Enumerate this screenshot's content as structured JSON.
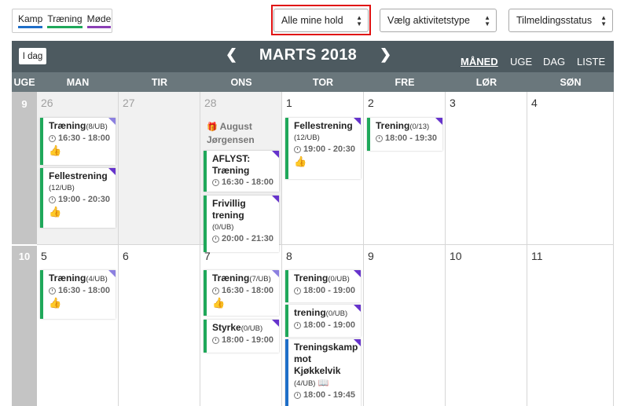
{
  "legend": {
    "kamp": "Kamp",
    "traening": "Træning",
    "mode": "Møde"
  },
  "filters": {
    "team": "Alle mine hold",
    "activity": "Vælg aktivitetstype",
    "status": "Tilmeldingsstatus"
  },
  "header": {
    "today": "I dag",
    "title": "MARTS 2018",
    "prev": "‹",
    "next": "›",
    "views": [
      "MÅNED",
      "UGE",
      "DAG",
      "LISTE"
    ],
    "active_view": "MÅNED"
  },
  "weekdays": [
    "UGE",
    "MAN",
    "TIR",
    "ONS",
    "TOR",
    "FRE",
    "LØR",
    "SØN"
  ],
  "colors": {
    "kamp": "#1e6ec8",
    "traening": "#1fa85a",
    "mode": "#8b3fb5",
    "header": "#4d5a60",
    "highlight": "#e01010"
  },
  "weeks": [
    {
      "number": "9",
      "days": [
        "26",
        "27",
        "28",
        "1",
        "2",
        "3",
        "4"
      ],
      "birthday": {
        "icon": "gift-icon",
        "name": "August Jørgensen"
      }
    },
    {
      "number": "10",
      "days": [
        "5",
        "6",
        "7",
        "8",
        "9",
        "10",
        "11"
      ]
    }
  ],
  "events": {
    "mon26_1": {
      "title": "Træning",
      "count": "(8/UB)",
      "time": "16:30 - 18:00"
    },
    "mon26_2": {
      "title": "Fellestrening",
      "count": "(12/UB)",
      "time": "19:00 - 20:30"
    },
    "wed28_1": {
      "title": "AFLYST: Træning",
      "time": "16:30 - 18:00"
    },
    "wed28_2": {
      "title": "Frivillig trening",
      "count": "(0/UB)",
      "time": "20:00 - 21:30"
    },
    "thu1_1": {
      "title": "Fellestrening",
      "count": "(12/UB)",
      "time": "19:00 - 20:30"
    },
    "fri2_1": {
      "title": "Trening",
      "count": "(0/13)",
      "time": "18:00 - 19:30"
    },
    "mon5_1": {
      "title": "Træning",
      "count": "(4/UB)",
      "time": "16:30 - 18:00"
    },
    "wed7_1": {
      "title": "Træning",
      "count": "(7/UB)",
      "time": "16:30 - 18:00"
    },
    "wed7_2": {
      "title": "Styrke",
      "count": "(0/UB)",
      "time": "18:00 - 19:00"
    },
    "thu8_1": {
      "title": "Trening",
      "count": "(0/UB)",
      "time": "18:00 - 19:00"
    },
    "thu8_2": {
      "title": "trening",
      "count": "(0/UB)",
      "time": "18:00 - 19:00"
    },
    "thu8_3": {
      "title": "Treningskamp mot Kjøkkelvik",
      "count": "(4/UB)",
      "time": "18:00 - 19:45"
    }
  }
}
